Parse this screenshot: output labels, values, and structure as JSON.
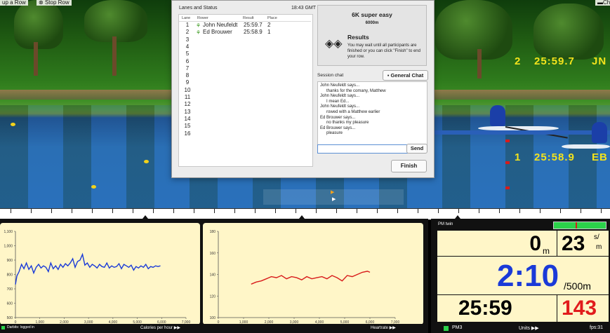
{
  "top_toolbar": {
    "left_label": "up a Row",
    "stop_label": "Stop Row",
    "right_label": "Cha"
  },
  "scene": {
    "lanes": [
      {
        "lane": "2",
        "time": "25:59.7",
        "initials": "JN"
      },
      {
        "lane": "1",
        "time": "25:58.9",
        "initials": "EB"
      }
    ]
  },
  "dialog": {
    "lanes_title": "Lanes and Status",
    "clock": "18:43 GMT",
    "columns": {
      "lane": "Lane",
      "rower": "Rower",
      "result": "Result",
      "place": "Place"
    },
    "rows": [
      {
        "lane": "1",
        "rower": "John Neufeldt",
        "result": "25:59.7",
        "place": "2"
      },
      {
        "lane": "2",
        "rower": "Ed Brouwer",
        "result": "25:58.9",
        "place": "1"
      },
      {
        "lane": "3",
        "rower": "",
        "result": "",
        "place": ""
      },
      {
        "lane": "4",
        "rower": "",
        "result": "",
        "place": ""
      },
      {
        "lane": "5",
        "rower": "",
        "result": "",
        "place": ""
      },
      {
        "lane": "6",
        "rower": "",
        "result": "",
        "place": ""
      },
      {
        "lane": "7",
        "rower": "",
        "result": "",
        "place": ""
      },
      {
        "lane": "8",
        "rower": "",
        "result": "",
        "place": ""
      },
      {
        "lane": "9",
        "rower": "",
        "result": "",
        "place": ""
      },
      {
        "lane": "10",
        "rower": "",
        "result": "",
        "place": ""
      },
      {
        "lane": "11",
        "rower": "",
        "result": "",
        "place": ""
      },
      {
        "lane": "12",
        "rower": "",
        "result": "",
        "place": ""
      },
      {
        "lane": "13",
        "rower": "",
        "result": "",
        "place": ""
      },
      {
        "lane": "14",
        "rower": "",
        "result": "",
        "place": ""
      },
      {
        "lane": "15",
        "rower": "",
        "result": "",
        "place": ""
      },
      {
        "lane": "16",
        "rower": "",
        "result": "",
        "place": ""
      }
    ],
    "workout_title": "6K super easy",
    "workout_distance": "6000m",
    "results_title": "Results",
    "results_text": "You may wait until all participants are finished or you can click \"Finish\" to end your row.",
    "chat_title": "Session chat",
    "general_chat_label": "General Chat",
    "chat_lines": [
      {
        "text": "John Neufeldt says...",
        "indent": false
      },
      {
        "text": "thanks for the comany, Matthew",
        "indent": true
      },
      {
        "text": "John Neufeldt says...",
        "indent": false
      },
      {
        "text": "I mean Ed...",
        "indent": true
      },
      {
        "text": "John Neufeldt says...",
        "indent": false
      },
      {
        "text": "rowed with a Matthew earlier",
        "indent": true
      },
      {
        "text": "Ed Brouwer says...",
        "indent": false
      },
      {
        "text": "no thanks my pleasure",
        "indent": true
      },
      {
        "text": "Ed Brouwer says...",
        "indent": false
      },
      {
        "text": "pleasure",
        "indent": true
      }
    ],
    "chat_input_value": "",
    "send_label": "Send",
    "finish_label": "Finish"
  },
  "charts_bar": {
    "status_text": "Darbits: logged in",
    "left_chart_label": "Calories per hour",
    "right_chart_label": "Heartrate"
  },
  "chart_data": [
    {
      "type": "line",
      "title": "Calories per hour",
      "ylim": [
        500,
        1100
      ],
      "xlim": [
        0,
        7000
      ],
      "yticks": [
        "1,100",
        "1,000",
        "900",
        "800",
        "700",
        "600",
        "500"
      ],
      "xticks": [
        "0",
        "1,000",
        "2,000",
        "3,000",
        "4,000",
        "5,000",
        "6,000",
        "7,000"
      ],
      "series": [
        {
          "x": [
            0,
            60,
            150,
            250,
            350,
            450,
            550,
            650,
            750,
            850,
            950,
            1050,
            1150,
            1250,
            1350,
            1450,
            1550,
            1650,
            1750,
            1850,
            1950,
            2050,
            2150,
            2250,
            2350,
            2450,
            2550,
            2650,
            2750,
            2850,
            2950,
            3050,
            3150,
            3250,
            3350,
            3450,
            3550,
            3650,
            3750,
            3850,
            3950,
            4050,
            4150,
            4250,
            4350,
            4450,
            4550,
            4650,
            4750,
            4850,
            4950,
            5050,
            5150,
            5250,
            5350,
            5450,
            5550,
            5650,
            5750,
            5850,
            5950
          ],
          "values": [
            730,
            790,
            820,
            870,
            840,
            880,
            835,
            860,
            810,
            850,
            870,
            845,
            860,
            850,
            820,
            880,
            840,
            860,
            835,
            870,
            850,
            875,
            860,
            880,
            910,
            850,
            890,
            900,
            940,
            865,
            880,
            850,
            870,
            860,
            845,
            870,
            855,
            850,
            880,
            845,
            860,
            850,
            855,
            875,
            840,
            870,
            860,
            850,
            865,
            830,
            855,
            845,
            860,
            850,
            870,
            840,
            855,
            850,
            860,
            855,
            860
          ]
        }
      ]
    },
    {
      "type": "line",
      "title": "Heartrate",
      "ylim": [
        100,
        180
      ],
      "xlim": [
        0,
        7000
      ],
      "yticks": [
        "180",
        "160",
        "140",
        "120",
        "100"
      ],
      "xticks": [
        "0",
        "1,000",
        "2,000",
        "3,000",
        "4,000",
        "5,000",
        "6,000",
        "7,000"
      ],
      "series": [
        {
          "x": [
            1300,
            1500,
            1700,
            1900,
            2100,
            2300,
            2500,
            2700,
            2900,
            3100,
            3300,
            3500,
            3700,
            3900,
            4100,
            4300,
            4500,
            4700,
            4900,
            5100,
            5300,
            5500,
            5700,
            5900,
            6000
          ],
          "values": [
            131,
            133,
            134,
            136,
            138,
            137,
            139,
            136,
            138,
            137,
            135,
            138,
            136,
            137,
            138,
            136,
            139,
            137,
            134,
            139,
            138,
            140,
            142,
            143,
            142
          ]
        }
      ]
    }
  ],
  "pm": {
    "title": "PM twin",
    "distance": "0",
    "distance_unit": "m",
    "stroke_rate": "23",
    "stroke_unit_top": "s/",
    "stroke_unit_bottom": "m",
    "pace": "2:10",
    "pace_unit": "/500m",
    "elapsed": "25:59",
    "heart_rate": "143",
    "footer_left": "PM3",
    "footer_mid": "Units",
    "footer_right": "fps:31",
    "colors": {
      "pace": "#1a3ad8",
      "heart_rate": "#e11c1c",
      "status_green": "#2bd24a"
    }
  }
}
